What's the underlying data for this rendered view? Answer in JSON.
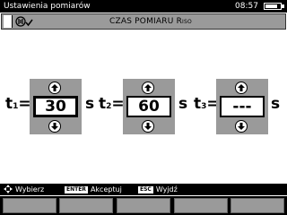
{
  "window": {
    "title": "Ustawienia pomiarów",
    "time": "08:57",
    "battery_level": 0.8
  },
  "header": {
    "heading": "CZAS POMIARU R",
    "heading_sub": "ISO",
    "mode_icon": "insulation-meter-check-icon"
  },
  "times": [
    {
      "label": "t",
      "index": "1",
      "suffix": "=",
      "value": "30",
      "unit": "s",
      "selected": true
    },
    {
      "label": "t",
      "index": "2",
      "suffix": "=",
      "value": "60",
      "unit": "s",
      "selected": false
    },
    {
      "label": "t",
      "index": "3",
      "suffix": "=",
      "value": "---",
      "unit": "s",
      "selected": false
    }
  ],
  "help": {
    "nav_icon": "dpad-icon",
    "nav_label": "Wybierz",
    "enter_key": "ENTER",
    "enter_label": "Akceptuj",
    "esc_key": "ESC",
    "esc_label": "Wyjdź"
  },
  "colors": {
    "panel_gray": "#9a9a9a",
    "bar_black": "#000000",
    "background": "#ffffff"
  }
}
